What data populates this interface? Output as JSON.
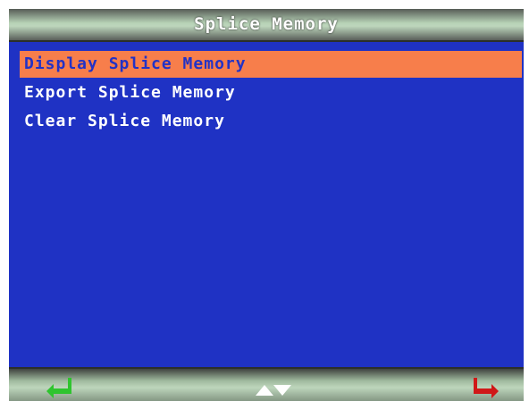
{
  "title": "Splice Memory",
  "menu": {
    "items": [
      {
        "label": "Display Splice Memory",
        "selected": true
      },
      {
        "label": "Export Splice Memory",
        "selected": false
      },
      {
        "label": "Clear Splice Memory",
        "selected": false
      }
    ]
  },
  "softkeys": {
    "left_icon": "enter-arrow-icon",
    "center_icon": "up-down-arrows-icon",
    "right_icon": "return-arrow-icon"
  },
  "colors": {
    "background": "#1f32c4",
    "selection": "#f77e4b",
    "enter_icon": "#2fc42f",
    "return_icon": "#d01818",
    "nav_icon": "#ffffff"
  }
}
